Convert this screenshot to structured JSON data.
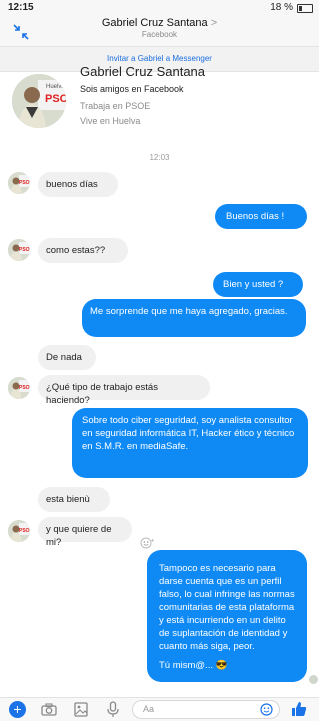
{
  "status": {
    "time": "12:15",
    "battery": "18 %"
  },
  "header": {
    "name": "Gabriel Cruz Santana",
    "subtitle": "Facebook"
  },
  "invite": {
    "label": "Invitar a Gabriel a Messenger"
  },
  "profile": {
    "name": "Gabriel Cruz Santana",
    "friends": "Sois amigos en Facebook",
    "work": "Trabaja en PSOE",
    "lives": "Vive en Huelva",
    "avatar_text": "Huelva PSO"
  },
  "chat": {
    "timestamp": "12:03",
    "messages": [
      {
        "dir": "in",
        "text": "buenos días"
      },
      {
        "dir": "out",
        "text": "Buenos días !"
      },
      {
        "dir": "in",
        "text": "como estas??"
      },
      {
        "dir": "out",
        "text": "Bien y usted ?"
      },
      {
        "dir": "out",
        "text": "Me sorprende que me haya agregado, gracias."
      },
      {
        "dir": "in",
        "text": "De nada"
      },
      {
        "dir": "in",
        "text": "¿Qué tipo de trabajo estás haciendo?"
      },
      {
        "dir": "out",
        "text": "Sobre todo ciber seguridad, soy analista consultor en seguridad informática IT, Hacker ético y técnico en S.M.R. en mediaSafe."
      },
      {
        "dir": "in",
        "text": "esta bienù"
      },
      {
        "dir": "in",
        "text": "y que quiere de mi?"
      },
      {
        "dir": "out",
        "text": "Tampoco es necesario para darse cuenta que es un perfil falso, lo cual infringe las normas comunitarias de esta plataforma y está incurriendo en un delito de suplantación de identidad y cuanto más siga, peor.",
        "extra": "Tú mism@... 😎"
      }
    ]
  },
  "composer": {
    "placeholder": "Aa"
  },
  "icons": [
    "collapse-icon",
    "add-icon",
    "camera-icon",
    "gallery-icon",
    "microphone-icon",
    "emoji-icon",
    "thumbs-up-icon",
    "reaction-icon"
  ],
  "colors": {
    "outgoing": "#0f8af5",
    "incoming": "#f0f0f0",
    "accent": "#1b73e8"
  }
}
